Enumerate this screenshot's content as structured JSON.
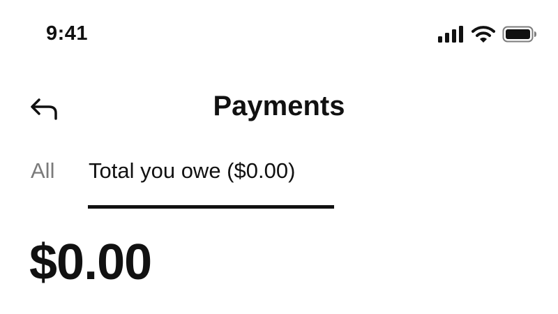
{
  "status_bar": {
    "time": "9:41",
    "icons": [
      "cellular-signal-icon",
      "wifi-icon",
      "battery-icon"
    ]
  },
  "header": {
    "back_icon": "back-arrow-icon",
    "title": "Payments"
  },
  "tabs": [
    {
      "label": "All",
      "active": false
    },
    {
      "label": "Total you owe ($0.00)",
      "active": true
    }
  ],
  "summary": {
    "amount": "$0.00"
  },
  "colors": {
    "text": "#111111",
    "inactive_tab": "#7a7a7a",
    "background": "#ffffff"
  }
}
